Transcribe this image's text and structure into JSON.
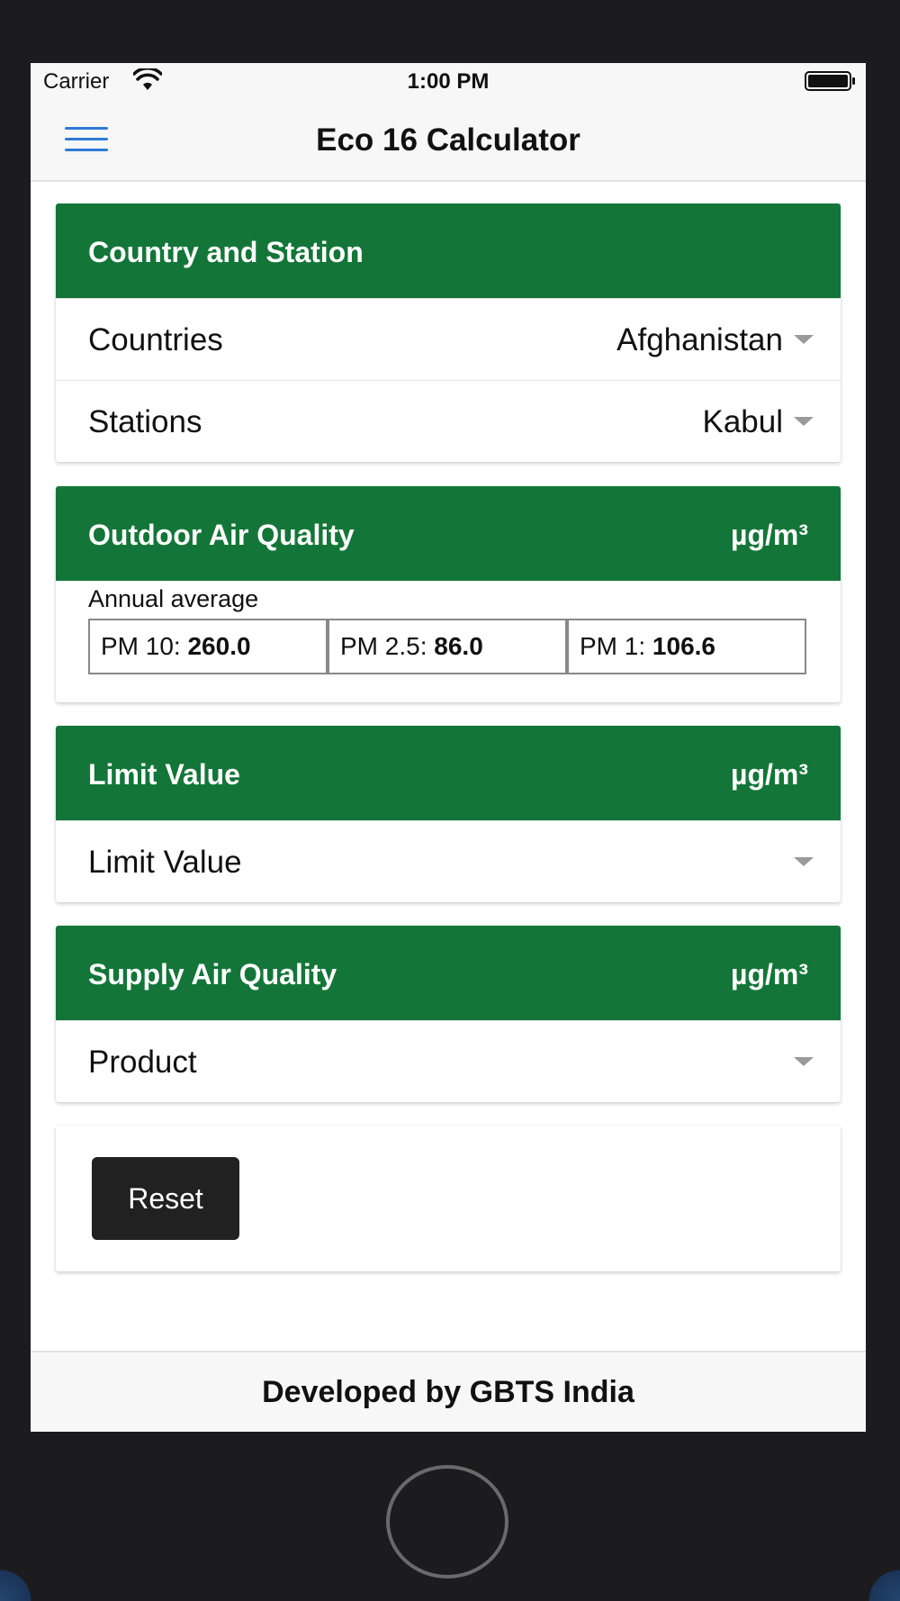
{
  "status_bar": {
    "carrier": "Carrier",
    "time": "1:00 PM",
    "wifi_icon": "wifi-icon",
    "battery_icon": "battery-icon"
  },
  "nav": {
    "title": "Eco 16 Calculator",
    "menu_icon": "hamburger-menu-icon",
    "menu_color": "#2f7ad8"
  },
  "colors": {
    "header_green": "#137638",
    "button_dark": "#212121"
  },
  "country_station": {
    "title": "Country and Station",
    "countries_label": "Countries",
    "countries_value": "Afghanistan",
    "stations_label": "Stations",
    "stations_value": "Kabul"
  },
  "outdoor_air": {
    "title": "Outdoor Air Quality",
    "unit": "µg/m³",
    "annual_label": "Annual average",
    "pm10_label": "PM 10:",
    "pm10_value": "260.0",
    "pm25_label": "PM 2.5:",
    "pm25_value": "86.0",
    "pm1_label": "PM 1:",
    "pm1_value": "106.6"
  },
  "limit_value": {
    "title": "Limit Value",
    "unit": "µg/m³",
    "select_label": "Limit Value"
  },
  "supply_air": {
    "title": "Supply Air Quality",
    "unit": "µg/m³",
    "select_label": "Product"
  },
  "actions": {
    "reset_label": "Reset"
  },
  "footer": {
    "text": "Developed by GBTS India"
  }
}
